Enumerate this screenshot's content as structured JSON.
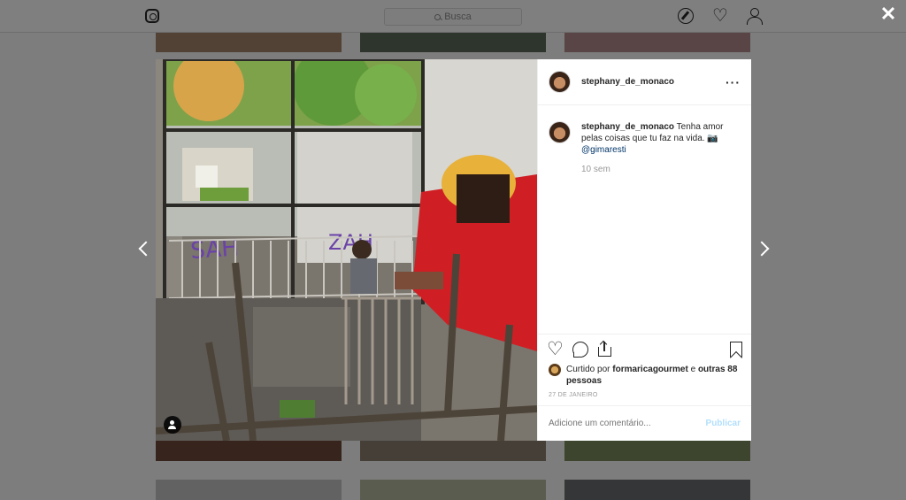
{
  "header": {
    "logo_icon": "instagram-glyph-icon",
    "search_placeholder": "Busca",
    "nav_icons": [
      "compass-icon",
      "heart-icon",
      "profile-icon"
    ]
  },
  "modal": {
    "close_icon": "close-icon",
    "prev_icon": "chevron-left-icon",
    "next_icon": "chevron-right-icon",
    "post": {
      "username": "stephany_de_monaco",
      "more_icon": "more-horizontal-icon",
      "caption": {
        "username": "stephany_de_monaco",
        "text": "Tenha amor pelas coisas que tu faz na vida.",
        "camera_emoji": "📷",
        "mention": "@gimaresti",
        "time": "10 sem"
      },
      "likes": {
        "prefix": "Curtido por",
        "user": "formaricagourmet",
        "connector": "e",
        "others": "outras 88 pessoas"
      },
      "date": "27 DE JANEIRO",
      "comment_placeholder": "Adicione um comentário...",
      "publish_label": "Publicar"
    }
  },
  "colors": {
    "overlay": "#000000",
    "link": "#003569",
    "publish_disabled": "#b2dffc",
    "muted": "#999999"
  }
}
